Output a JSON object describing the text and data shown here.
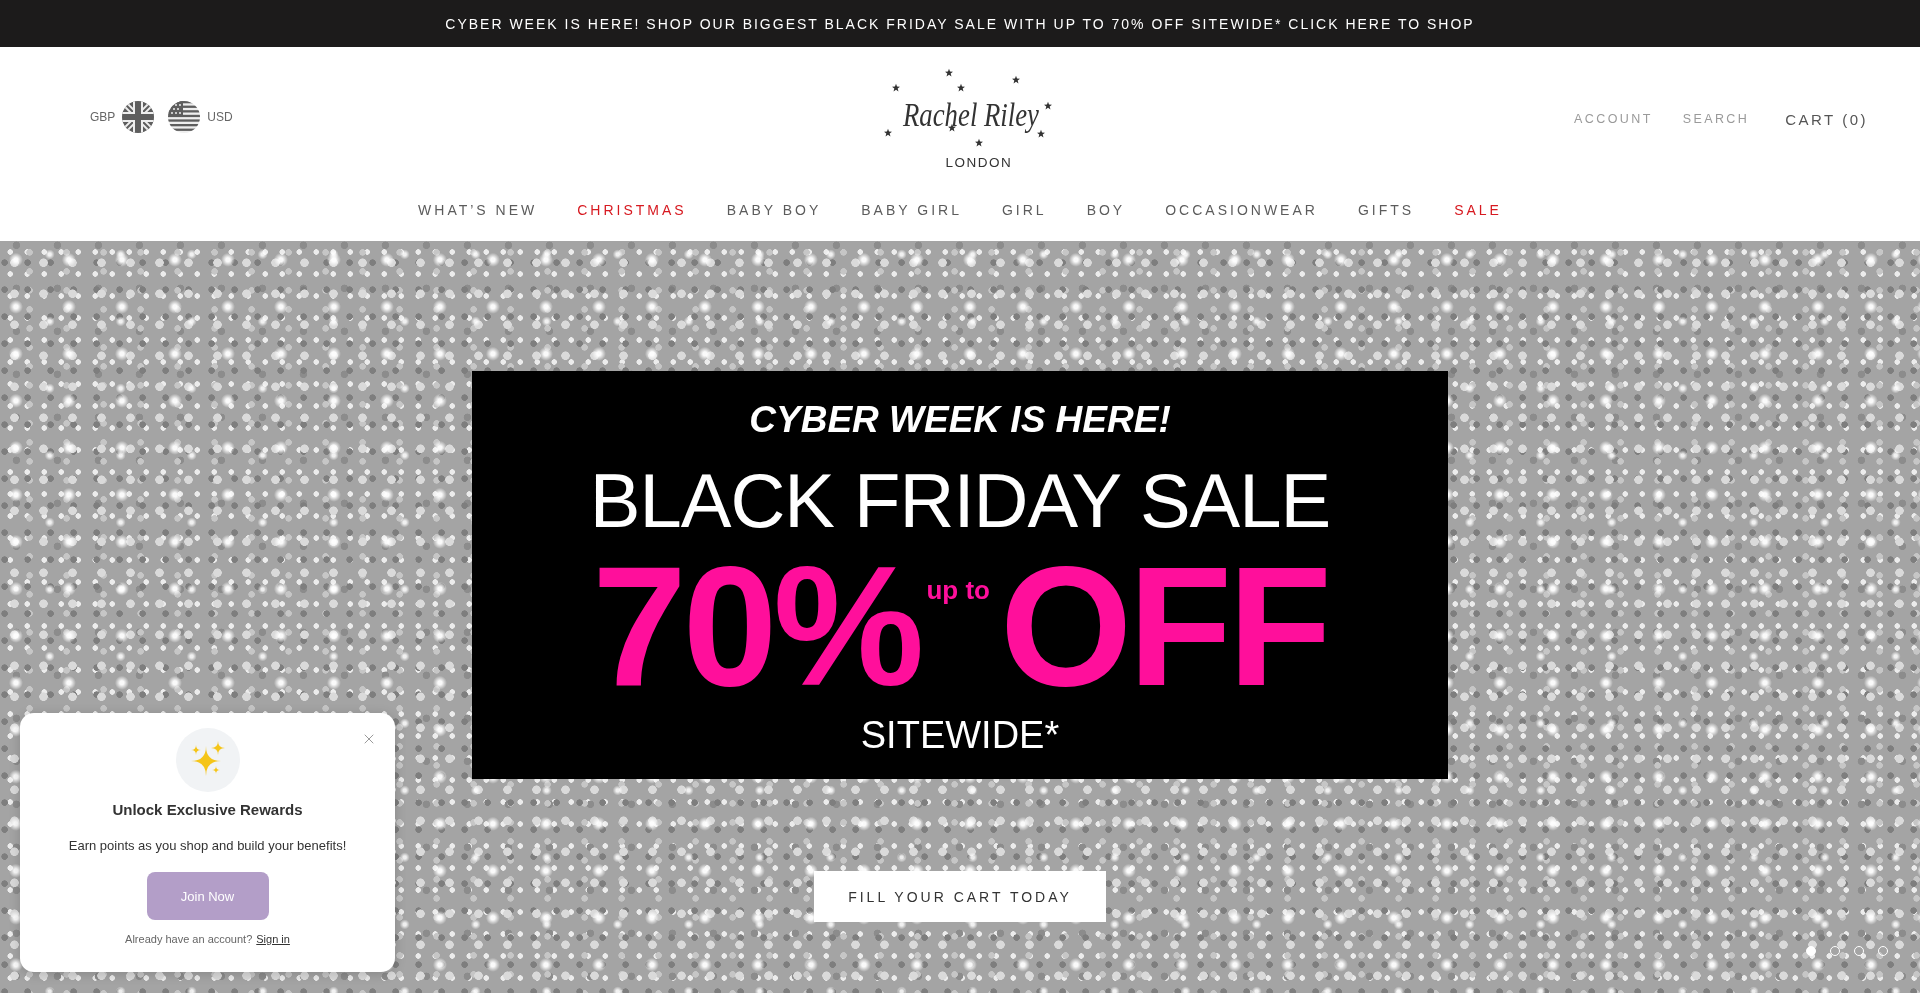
{
  "announcement": {
    "text": "CYBER WEEK IS HERE! SHOP OUR BIGGEST BLACK FRIDAY SALE WITH UP TO 70% OFF SITEWIDE* CLICK HERE TO SHOP"
  },
  "header": {
    "currencies": [
      {
        "code": "GBP",
        "kind": "uk"
      },
      {
        "code": "USD",
        "kind": "us"
      }
    ],
    "logo": {
      "script": "Rachel Riley",
      "subtitle": "LONDON"
    },
    "links": [
      {
        "label": "ACCOUNT",
        "kind": "utility"
      },
      {
        "label": "SEARCH",
        "kind": "utility"
      },
      {
        "label": "CART (0)",
        "kind": "cart"
      }
    ]
  },
  "nav": {
    "items": [
      {
        "label": "WHAT’S NEW",
        "color": "#5c5c5c"
      },
      {
        "label": "CHRISTMAS",
        "color": "#d71920"
      },
      {
        "label": "BABY BOY",
        "color": "#5c5c5c"
      },
      {
        "label": "BABY GIRL",
        "color": "#5c5c5c"
      },
      {
        "label": "GIRL",
        "color": "#5c5c5c"
      },
      {
        "label": "BOY",
        "color": "#5c5c5c"
      },
      {
        "label": "OCCASIONWEAR",
        "color": "#5c5c5c"
      },
      {
        "label": "GIFTS",
        "color": "#5c5c5c"
      },
      {
        "label": "SALE",
        "color": "#d71920"
      }
    ]
  },
  "hero": {
    "banner": {
      "kicker": "CYBER WEEK IS HERE!",
      "headline": "BLACK FRIDAY SALE",
      "discount": "70%",
      "discount_note": "up to",
      "off": "OFF",
      "footer": "SITEWIDE*"
    },
    "cta": "FILL YOUR CART TODAY",
    "slides": [
      {
        "selected": true
      },
      {
        "selected": false
      },
      {
        "selected": false
      },
      {
        "selected": false
      }
    ]
  },
  "rewards_popup": {
    "title": "Unlock Exclusive Rewards",
    "body": "Earn points as you shop and build your benefits!",
    "button": "Join Now",
    "prompt": "Already have an account?",
    "link": "Sign in"
  }
}
